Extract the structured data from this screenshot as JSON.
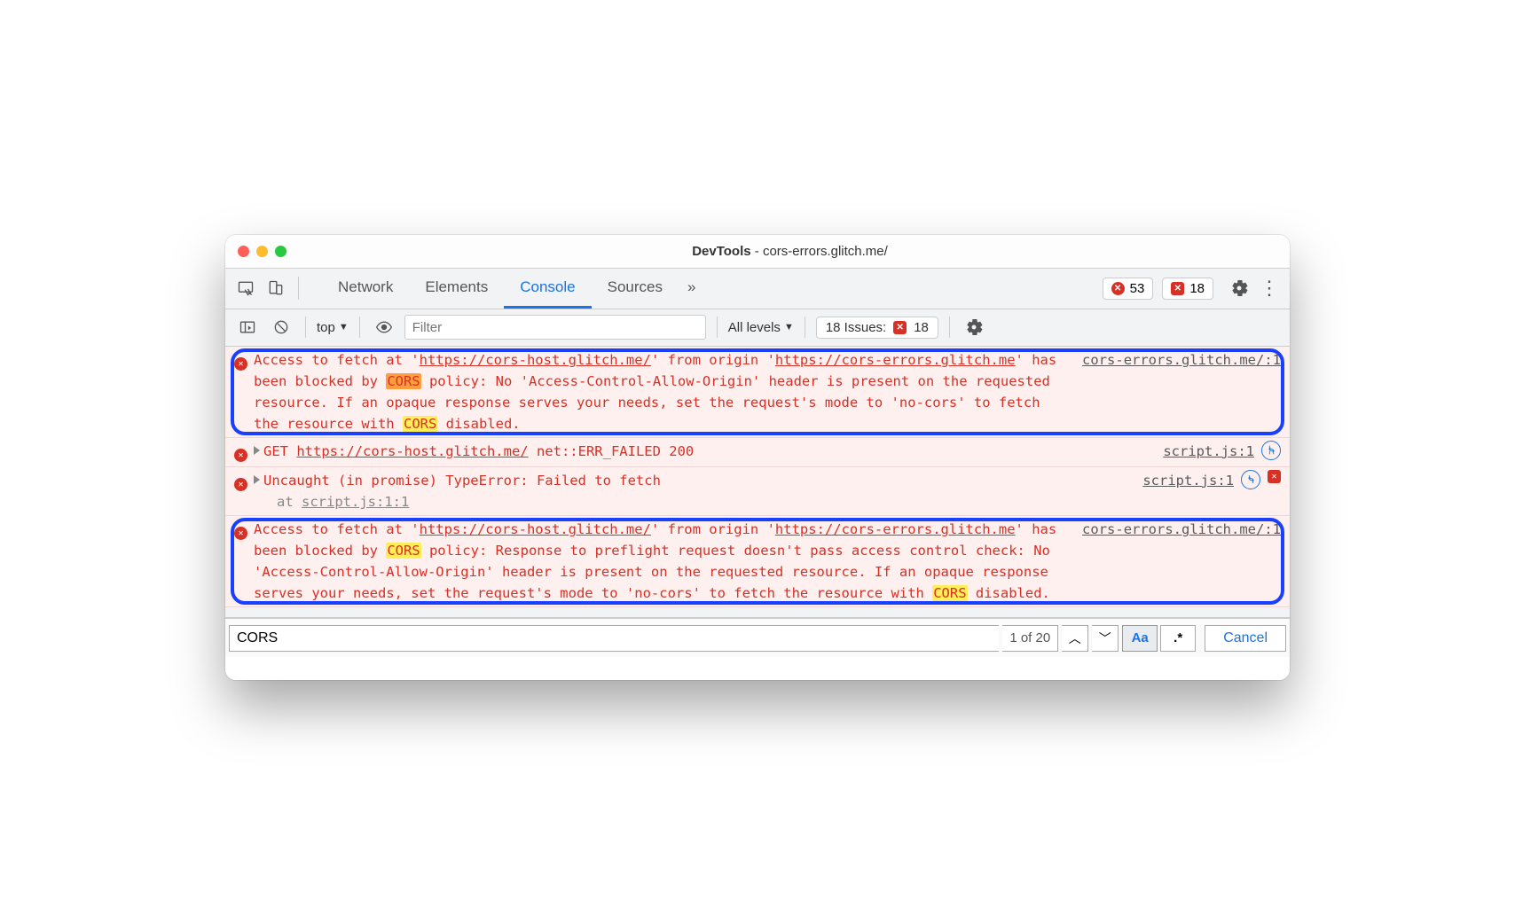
{
  "window": {
    "title_prefix": "DevTools",
    "title_url": "cors-errors.glitch.me/"
  },
  "tabs": {
    "items": [
      "Network",
      "Elements",
      "Console",
      "Sources"
    ],
    "active_index": 2
  },
  "counters": {
    "errors": "53",
    "issues": "18"
  },
  "toolbar": {
    "context": "top",
    "filter_placeholder": "Filter",
    "levels_label": "All levels",
    "issues_label": "18 Issues:",
    "issues_count": "18"
  },
  "messages": [
    {
      "kind": "error",
      "highlight": true,
      "source": "cors-errors.glitch.me/:1",
      "t1": "Access to fetch at '",
      "u1": "https://cors-host.glitch.me/",
      "t2": "' from origin '",
      "u2": "https://cors-errors.glitch.me",
      "t3": "' has been blocked by ",
      "h1": "CORS",
      "h1class": "o",
      "t4": " policy: No 'Access-Control-Allow-Origin' header is present on the requested resource. If an opaque response serves your needs, set the request's mode to 'no-cors' to fetch the resource with ",
      "h2": "CORS",
      "h2class": "y",
      "t5": " disabled."
    },
    {
      "kind": "error",
      "highlight": false,
      "expandable": true,
      "nav": true,
      "source": "script.js:1",
      "pre": "GET ",
      "u1": "https://cors-host.glitch.me/",
      "post": " net::ERR_FAILED 200"
    },
    {
      "kind": "error",
      "highlight": false,
      "expandable": true,
      "nav": true,
      "sq": true,
      "source": "script.js:1",
      "line1": "Uncaught (in promise) TypeError: Failed to fetch",
      "at_prefix": "at ",
      "at_link": "script.js:1:1"
    },
    {
      "kind": "error",
      "highlight": true,
      "source": "cors-errors.glitch.me/:1",
      "t1": "Access to fetch at '",
      "u1": "https://cors-host.glitch.me/",
      "t2": "' from origin '",
      "u2": "https://cors-errors.glitch.me",
      "t3": "' has been blocked by ",
      "h1": "CORS",
      "h1class": "y",
      "t4": " policy: Response to preflight request doesn't pass access control check: No 'Access-Control-Allow-Origin' header is present on the requested resource. If an opaque response serves your needs, set the request's mode to 'no-cors' to fetch the resource with ",
      "h2": "CORS",
      "h2class": "y",
      "t5": " disabled."
    }
  ],
  "search": {
    "query": "CORS",
    "count": "1 of 20",
    "aa": "Aa",
    "regex": ".*",
    "cancel": "Cancel"
  }
}
